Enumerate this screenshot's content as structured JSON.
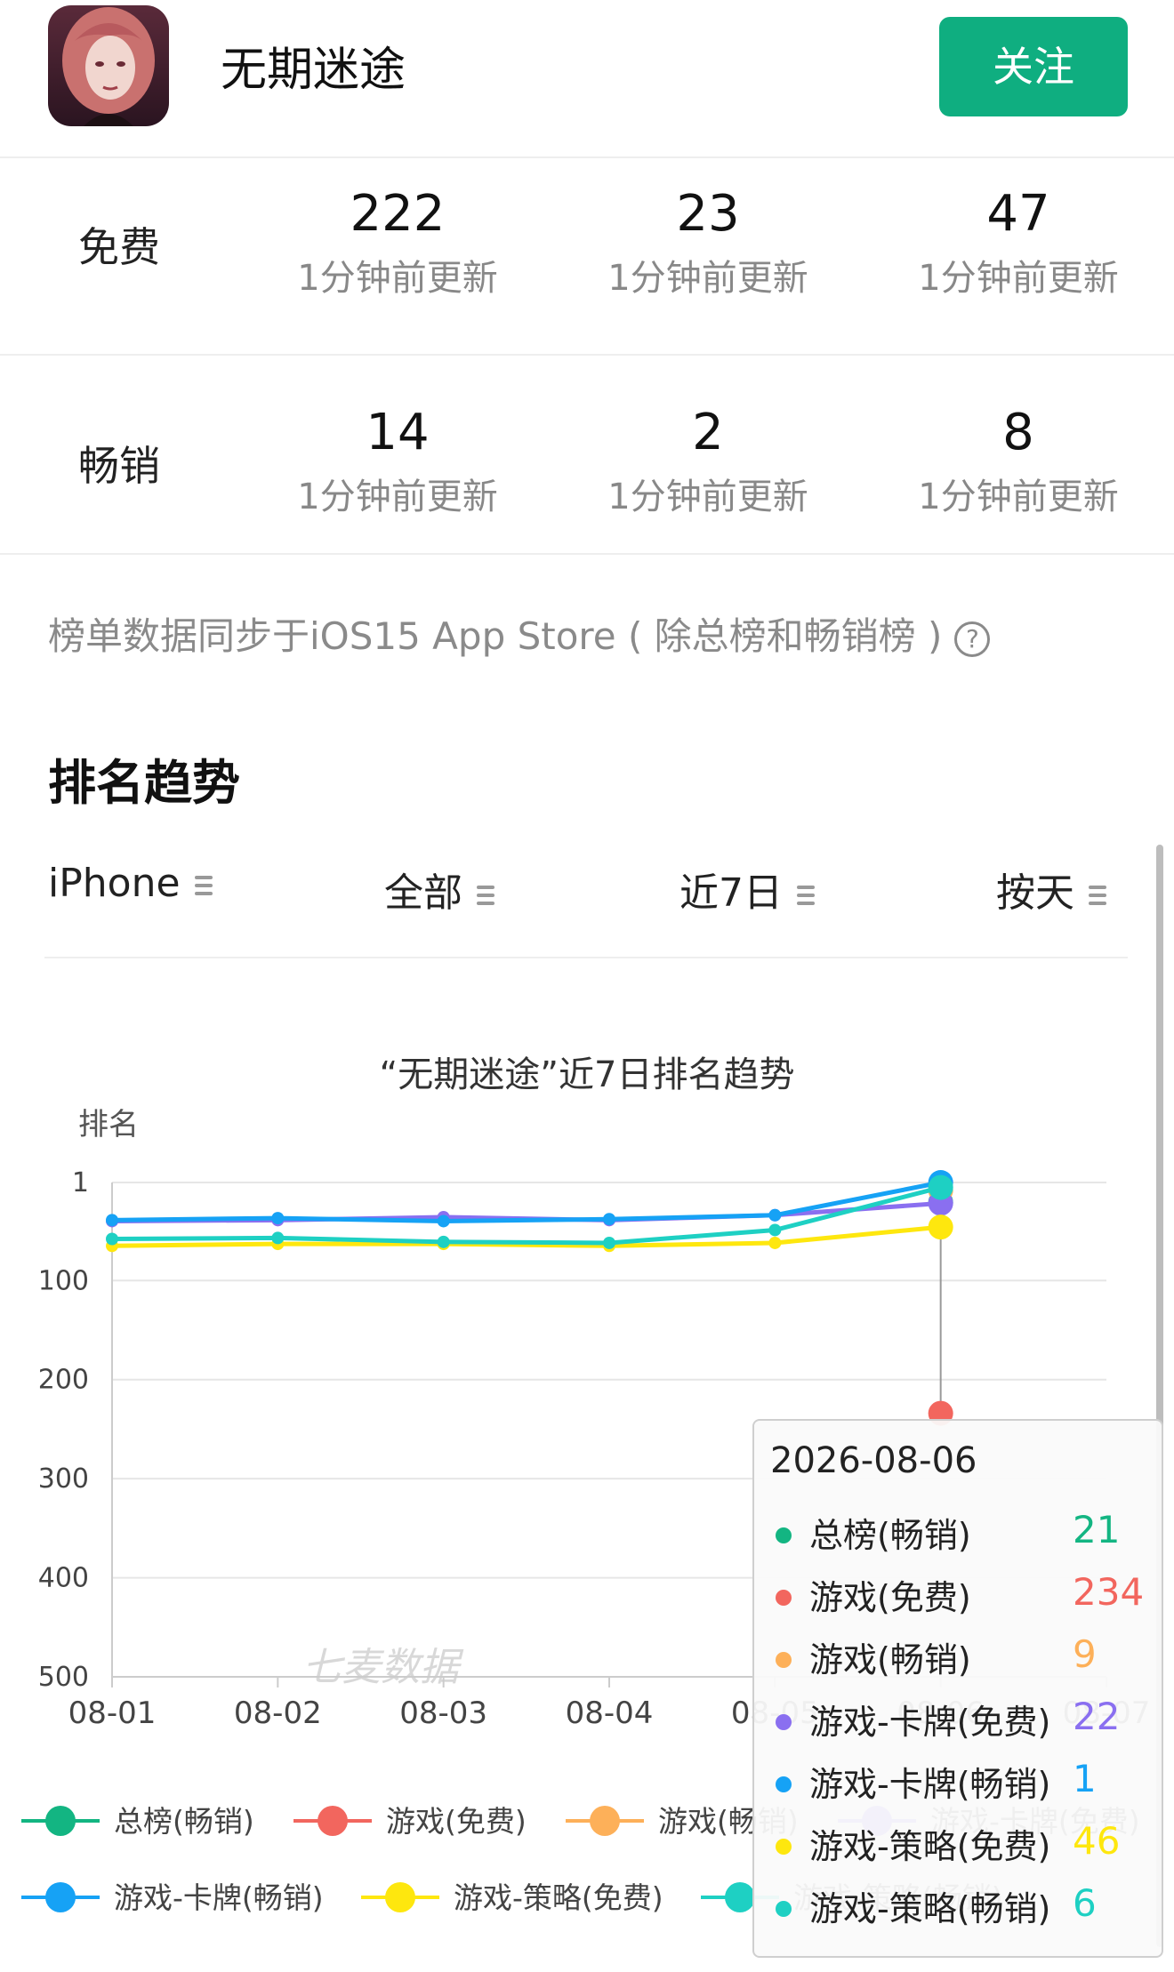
{
  "app": {
    "name": "无期迷途",
    "follow_label": "关注"
  },
  "ranks": [
    {
      "label": "免费",
      "cells": [
        {
          "value": "222",
          "updated": "1分钟前更新"
        },
        {
          "value": "23",
          "updated": "1分钟前更新"
        },
        {
          "value": "47",
          "updated": "1分钟前更新"
        }
      ]
    },
    {
      "label": "畅销",
      "cells": [
        {
          "value": "14",
          "updated": "1分钟前更新"
        },
        {
          "value": "2",
          "updated": "1分钟前更新"
        },
        {
          "value": "8",
          "updated": "1分钟前更新"
        }
      ]
    }
  ],
  "sync_note": "榜单数据同步于iOS15 App Store ( 除总榜和畅销榜 )",
  "trend": {
    "title": "排名趋势",
    "filters": [
      "iPhone",
      "全部",
      "近7日",
      "按天"
    ]
  },
  "chart_data": {
    "type": "line",
    "title": "“无期迷途”近7日排名趋势",
    "ylabel": "排名",
    "watermark": "七麦数据",
    "y_inverted": true,
    "ylim": [
      1,
      500
    ],
    "y_ticks": [
      "1",
      "100",
      "200",
      "300",
      "400",
      "500"
    ],
    "x": [
      "08-01",
      "08-02",
      "08-03",
      "08-04",
      "08-05",
      "08-06",
      "08-07"
    ],
    "series": [
      {
        "name": "总榜(畅销)",
        "color": "#13b582",
        "values": [
          null,
          null,
          null,
          null,
          null,
          21,
          null
        ]
      },
      {
        "name": "游戏(免费)",
        "color": "#f2665e",
        "values": [
          null,
          null,
          null,
          null,
          null,
          234,
          null
        ]
      },
      {
        "name": "游戏(畅销)",
        "color": "#fdb059",
        "values": [
          null,
          null,
          null,
          null,
          null,
          9,
          null
        ]
      },
      {
        "name": "游戏-卡牌(免费)",
        "color": "#8a6ff0",
        "values": [
          40,
          39,
          36,
          39,
          34,
          22,
          null
        ]
      },
      {
        "name": "游戏-卡牌(畅销)",
        "color": "#16a2f5",
        "values": [
          39,
          37,
          40,
          38,
          34,
          1,
          null
        ]
      },
      {
        "name": "游戏-策略(免费)",
        "color": "#fee70e",
        "values": [
          65,
          63,
          63,
          65,
          62,
          46,
          null
        ]
      },
      {
        "name": "游戏-策略(畅销)",
        "color": "#1ed0c3",
        "values": [
          58,
          57,
          61,
          62,
          49,
          6,
          null
        ]
      }
    ],
    "tooltip": {
      "date": "2026-08-06",
      "rows": [
        {
          "name": "总榜(畅销)",
          "value": "21",
          "color": "#13b582"
        },
        {
          "name": "游戏(免费)",
          "value": "234",
          "color": "#f2665e"
        },
        {
          "name": "游戏(畅销)",
          "value": "9",
          "color": "#fdb059"
        },
        {
          "name": "游戏-卡牌(免费)",
          "value": "22",
          "color": "#8a6ff0"
        },
        {
          "name": "游戏-卡牌(畅销)",
          "value": "1",
          "color": "#16a2f5"
        },
        {
          "name": "游戏-策略(免费)",
          "value": "46",
          "color": "#fee70e"
        },
        {
          "name": "游戏-策略(畅销)",
          "value": "6",
          "color": "#1ed0c3"
        }
      ]
    },
    "legend": [
      "总榜(畅销)",
      "游戏(免费)",
      "游戏(畅销)",
      "游戏-卡牌(免费)",
      "游戏-卡牌(畅销)",
      "游戏-策略(免费)",
      "游戏-策略(畅销)"
    ]
  }
}
